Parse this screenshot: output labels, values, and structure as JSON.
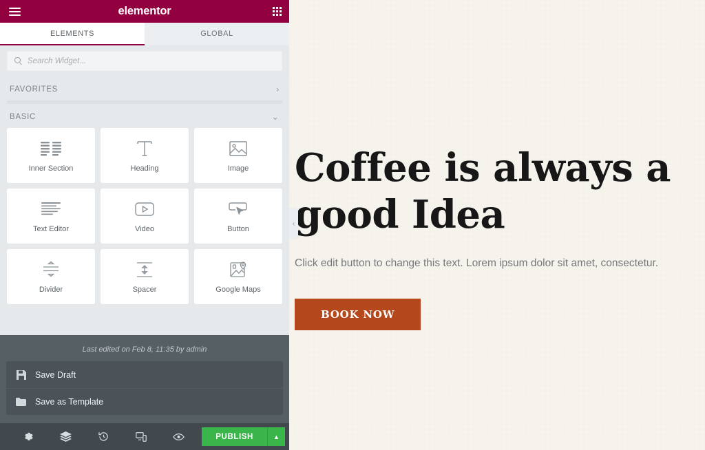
{
  "panel": {
    "header": {
      "brand": "elementor",
      "menu_icon": "hamburger-icon",
      "apps_icon": "apps-grid-icon"
    },
    "tabs": [
      {
        "label": "ELEMENTS",
        "active": true
      },
      {
        "label": "GLOBAL",
        "active": false
      }
    ],
    "search": {
      "placeholder": "Search Widget...",
      "value": "",
      "icon": "search-icon"
    },
    "categories": [
      {
        "label": "FAVORITES",
        "expanded": false,
        "chevron": "›"
      },
      {
        "label": "BASIC",
        "expanded": true,
        "chevron": "⌄"
      }
    ],
    "widgets": [
      {
        "label": "Inner Section",
        "icon": "inner-section-icon"
      },
      {
        "label": "Heading",
        "icon": "heading-icon"
      },
      {
        "label": "Image",
        "icon": "image-icon"
      },
      {
        "label": "Text Editor",
        "icon": "text-editor-icon"
      },
      {
        "label": "Video",
        "icon": "video-icon"
      },
      {
        "label": "Button",
        "icon": "button-icon"
      },
      {
        "label": "Divider",
        "icon": "divider-icon"
      },
      {
        "label": "Spacer",
        "icon": "spacer-icon"
      },
      {
        "label": "Google Maps",
        "icon": "google-maps-icon"
      }
    ]
  },
  "save_panel": {
    "last_edited": "Last edited on Feb 8, 11:35 by admin",
    "items": [
      {
        "label": "Save Draft",
        "icon": "floppy-disk-icon"
      },
      {
        "label": "Save as Template",
        "icon": "folder-icon"
      }
    ]
  },
  "footer": {
    "icons": [
      {
        "name": "settings-gear-icon"
      },
      {
        "name": "navigator-layers-icon"
      },
      {
        "name": "history-clock-icon"
      },
      {
        "name": "responsive-mode-icon"
      },
      {
        "name": "preview-eye-icon"
      }
    ],
    "publish_label": "PUBLISH",
    "publish_caret": "▲",
    "publish_color": "#39b54a"
  },
  "collapse_handle": {
    "chevron": "‹"
  },
  "canvas": {
    "heading": "Coffee is always a good Idea",
    "paragraph": "Click edit button to change this text. Lorem ipsum dolor sit amet, consectetur.",
    "button_label": "BOOK NOW",
    "button_color": "#b5471d",
    "background_color": "#f6f3ed"
  }
}
